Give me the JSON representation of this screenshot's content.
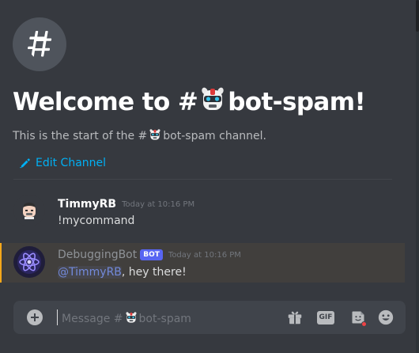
{
  "welcome": {
    "title_prefix": "Welcome to #",
    "channel_name": "bot-spam!",
    "subtitle_prefix": "This is the start of the #",
    "subtitle_suffix": "bot-spam channel.",
    "edit_channel_label": "Edit Channel"
  },
  "messages": [
    {
      "username": "TimmyRB",
      "timestamp": "Today at 10:16 PM",
      "content": "!mycommand"
    },
    {
      "username": "DebuggingBot",
      "bot_tag": "BOT",
      "timestamp": "Today at 10:16 PM",
      "mention": "@TimmyRB",
      "content": ", hey there!"
    }
  ],
  "composer": {
    "placeholder_prefix": "Message #",
    "placeholder_channel": "bot-spam",
    "gif_label": "GIF"
  },
  "colors": {
    "background": "#36393f",
    "link": "#00b0f4",
    "bot_tag": "#5865f2",
    "mention_highlight": "#faa81a"
  }
}
